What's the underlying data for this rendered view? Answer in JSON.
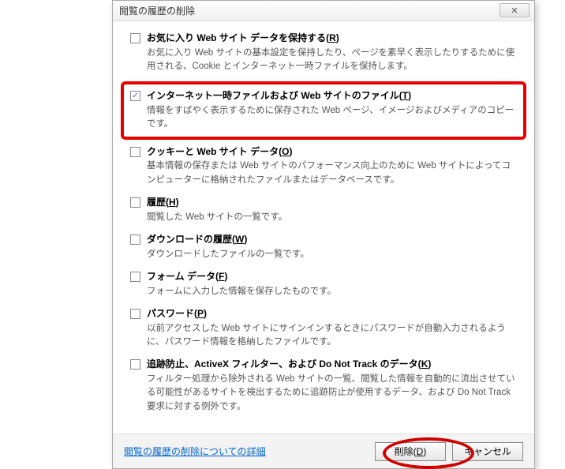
{
  "dialog": {
    "title": "閲覧の履歴の削除",
    "close_glyph": "✕"
  },
  "options": [
    {
      "checked": false,
      "label_pre": "お気に入り Web サイト データを保持する(",
      "accel": "R",
      "label_post": ")",
      "desc": "お気に入り Web サイトの基本設定を保持したり、ページを素早く表示したりするために使用される、Cookie とインターネット一時ファイルを保持します。"
    },
    {
      "checked": true,
      "highlight": true,
      "label_pre": "インターネット一時ファイルおよび Web サイトのファイル(",
      "accel": "T",
      "label_post": ")",
      "desc": "情報をすばやく表示するために保存された Web ページ、イメージおよびメディアのコピーです。"
    },
    {
      "checked": false,
      "label_pre": "クッキーと Web サイト データ(",
      "accel": "O",
      "label_post": ")",
      "desc": "基本情報の保存または Web サイトのパフォーマンス向上のために Web サイトによってコンピューターに格納されたファイルまたはデータベースです。"
    },
    {
      "checked": false,
      "label_pre": "履歴(",
      "accel": "H",
      "label_post": ")",
      "desc": "閲覧した Web サイトの一覧です。"
    },
    {
      "checked": false,
      "label_pre": "ダウンロードの履歴(",
      "accel": "W",
      "label_post": ")",
      "desc": "ダウンロードしたファイルの一覧です。"
    },
    {
      "checked": false,
      "label_pre": "フォーム データ(",
      "accel": "F",
      "label_post": ")",
      "desc": "フォームに入力した情報を保存したものです。"
    },
    {
      "checked": false,
      "label_pre": "パスワード(",
      "accel": "P",
      "label_post": ")",
      "desc": "以前アクセスした Web サイトにサインインするときにパスワードが自動入力されるように、パスワード情報を格納したファイルです。"
    },
    {
      "checked": false,
      "label_pre": "追跡防止、ActiveX フィルター、および Do Not Track のデータ(",
      "accel": "K",
      "label_post": ")",
      "desc": "フィルター処理から除外される Web サイトの一覧、閲覧した情報を自動的に流出させている可能性があるサイトを検出するために追跡防止が使用するデータ、および Do Not Track 要求に対する例外です。"
    }
  ],
  "footer": {
    "link": "閲覧の履歴の削除についての詳細",
    "delete_pre": "削除(",
    "delete_accel": "D",
    "delete_post": ")",
    "cancel": "キャンセル"
  }
}
